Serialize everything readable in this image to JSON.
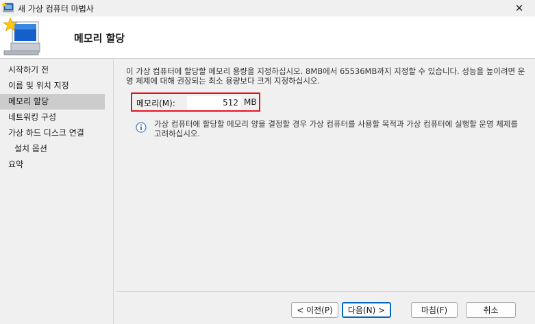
{
  "window": {
    "title": "새 가상 컴퓨터 마법사",
    "close_glyph": "✕"
  },
  "header": {
    "page_title": "메모리 할당",
    "icon": "wizard-computer-icon"
  },
  "nav": {
    "items": [
      {
        "label": "시작하기 전",
        "active": false
      },
      {
        "label": "이름 및 위치 지정",
        "active": false
      },
      {
        "label": "메모리 할당",
        "active": true
      },
      {
        "label": "네트워킹 구성",
        "active": false
      },
      {
        "label": "가상 하드 디스크 연결",
        "active": false
      },
      {
        "label": "설치 옵션",
        "active": false
      },
      {
        "label": "요약",
        "active": false
      }
    ]
  },
  "main": {
    "description": "이 가상 컴퓨터에 할당할 메모리 용량을 지정하십시오. 8MB에서 65536MB까지 지정할 수 있습니다. 성능을 높이려면 운영 체제에 대해 권장되는 최소 용량보다 크게 지정하십시오.",
    "memory": {
      "label": "메모리(M):",
      "value": "512",
      "unit": "MB",
      "highlight_color": "#e3131e"
    },
    "info_text": "가상 컴퓨터에 할당할 메모리 양을 결정할 경우 가상 컴퓨터를 사용할 목적과 가상 컴퓨터에 실행할 운영 체제를 고려하십시오.",
    "info_icon": "info-icon"
  },
  "buttons": {
    "previous": "< 이전(P)",
    "next": "다음(N) >",
    "finish": "마침(F)",
    "cancel": "취소"
  },
  "colors": {
    "accent": "#0067c0",
    "nav_selected": "#cccccc"
  }
}
